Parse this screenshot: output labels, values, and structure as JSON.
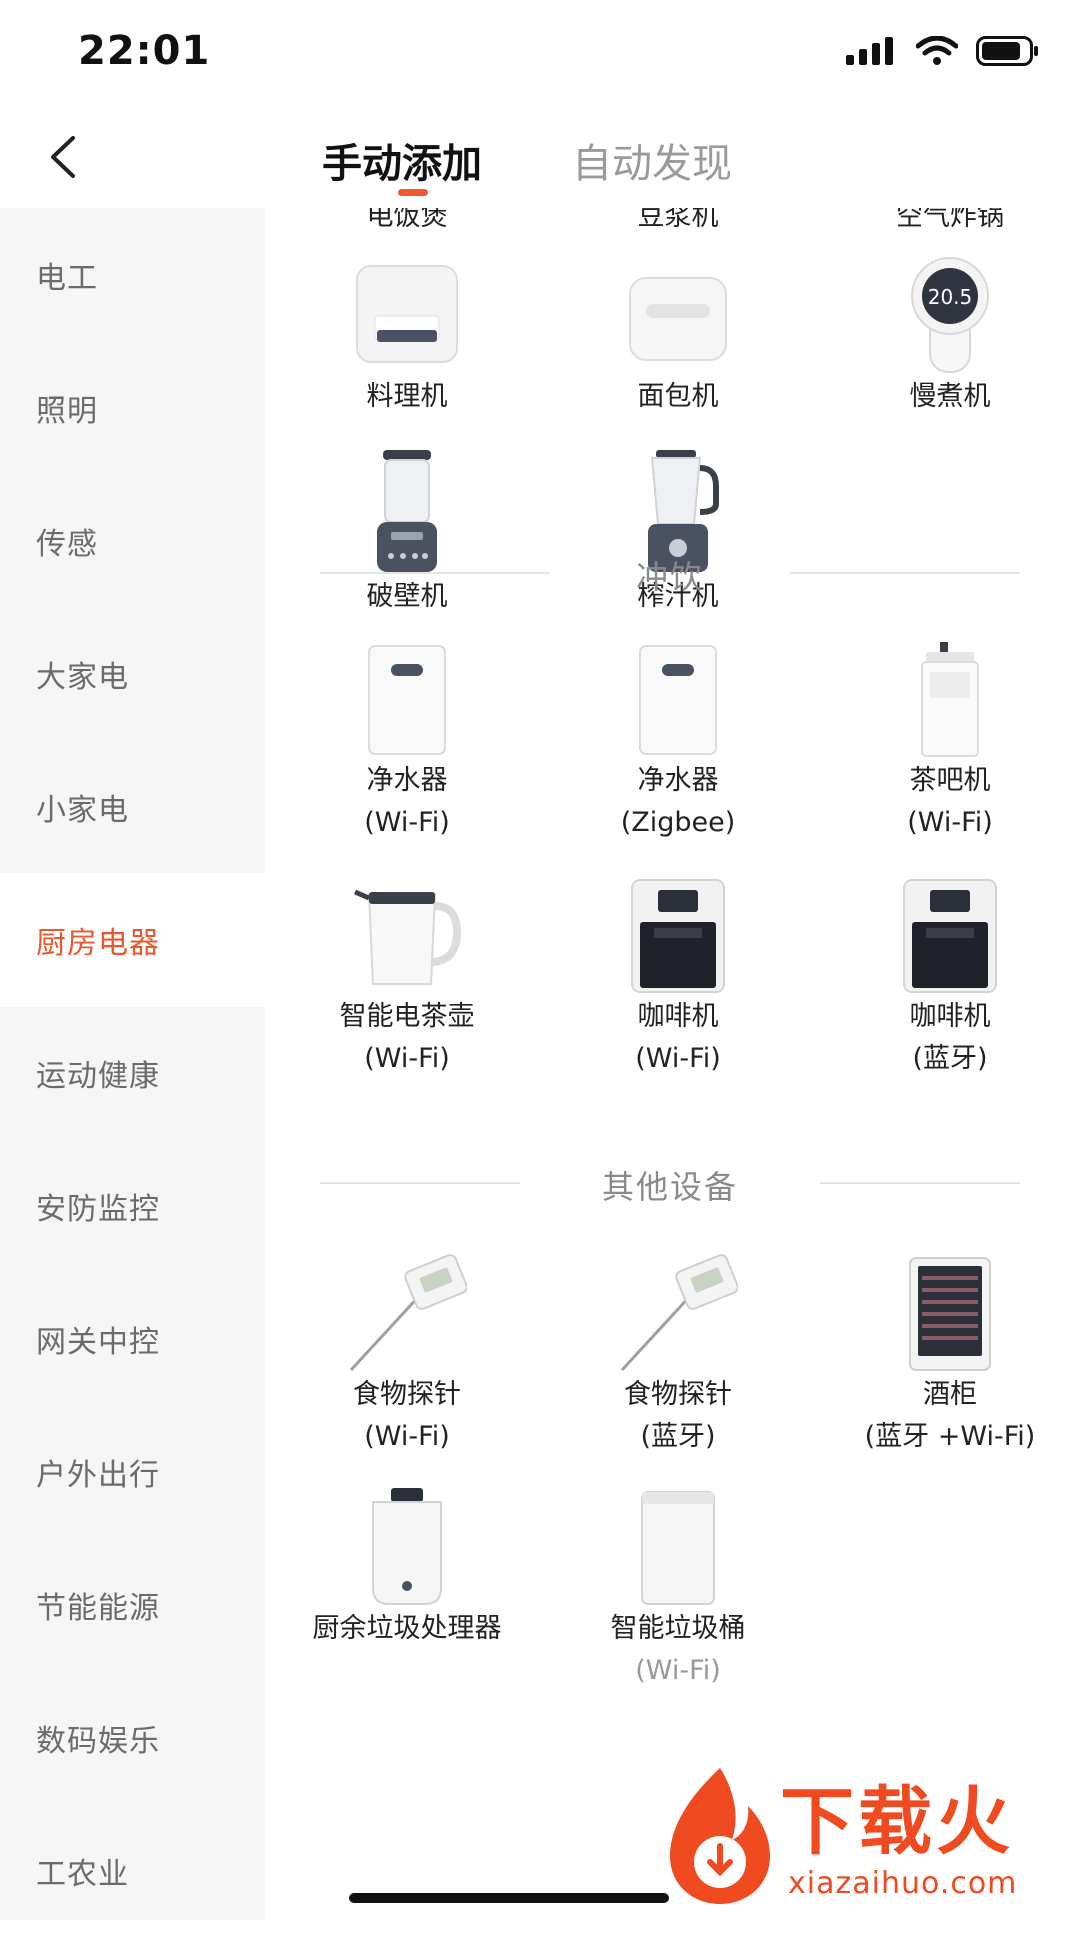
{
  "status_bar": {
    "time": "22:01"
  },
  "header": {
    "tabs": [
      {
        "label": "手动添加",
        "active": true
      },
      {
        "label": "自动发现",
        "active": false
      }
    ]
  },
  "sidebar": {
    "active_index": 5,
    "items": [
      {
        "label": "电工"
      },
      {
        "label": "照明"
      },
      {
        "label": "传感"
      },
      {
        "label": "大家电"
      },
      {
        "label": "小家电"
      },
      {
        "label": "厨房电器"
      },
      {
        "label": "运动健康"
      },
      {
        "label": "安防监控"
      },
      {
        "label": "网关中控"
      },
      {
        "label": "户外出行"
      },
      {
        "label": "节能能源"
      },
      {
        "label": "数码娱乐"
      },
      {
        "label": "工农业"
      }
    ]
  },
  "content": {
    "cut_row": [
      "电饭煲",
      "豆浆机",
      "空气炸锅"
    ],
    "kitchen_items": [
      {
        "name": "料理机",
        "icon": "food-processor-icon"
      },
      {
        "name": "面包机",
        "icon": "bread-maker-icon"
      },
      {
        "name": "慢煮机",
        "icon": "sous-vide-icon",
        "display": "20.5"
      },
      {
        "name": "破壁机",
        "icon": "high-speed-blender-icon"
      },
      {
        "name": "榨汁机",
        "icon": "juicer-icon"
      }
    ],
    "sections": [
      {
        "title": "冲饮",
        "items": [
          {
            "name": "净水器",
            "sub": "(Wi-Fi)",
            "icon": "water-purifier-icon"
          },
          {
            "name": "净水器",
            "sub": "(Zigbee)",
            "icon": "water-purifier-icon"
          },
          {
            "name": "茶吧机",
            "sub": "(Wi-Fi)",
            "icon": "tea-bar-machine-icon"
          },
          {
            "name": "智能电茶壶",
            "sub": "(Wi-Fi)",
            "icon": "electric-kettle-icon"
          },
          {
            "name": "咖啡机",
            "sub": "(Wi-Fi)",
            "icon": "coffee-machine-icon"
          },
          {
            "name": "咖啡机",
            "sub": "(蓝牙)",
            "icon": "coffee-machine-icon"
          }
        ]
      },
      {
        "title": "其他设备",
        "items": [
          {
            "name": "食物探针",
            "sub": "(Wi-Fi)",
            "icon": "food-probe-icon"
          },
          {
            "name": "食物探针",
            "sub": "(蓝牙)",
            "icon": "food-probe-icon"
          },
          {
            "name": "酒柜",
            "sub": "(蓝牙 +Wi-Fi)",
            "icon": "wine-cabinet-icon"
          },
          {
            "name": "厨余垃圾处理器",
            "sub": "",
            "icon": "food-waste-disposer-icon"
          },
          {
            "name": "智能垃圾桶",
            "sub": "(Wi-Fi)",
            "icon": "smart-trash-can-icon"
          }
        ]
      }
    ]
  },
  "watermark": {
    "text": "下载火",
    "url": "xiazaihuo.com"
  },
  "colors": {
    "accent": "#f0582f",
    "active_text": "#e8592f",
    "sidebar_bg": "#f6f6f6"
  }
}
